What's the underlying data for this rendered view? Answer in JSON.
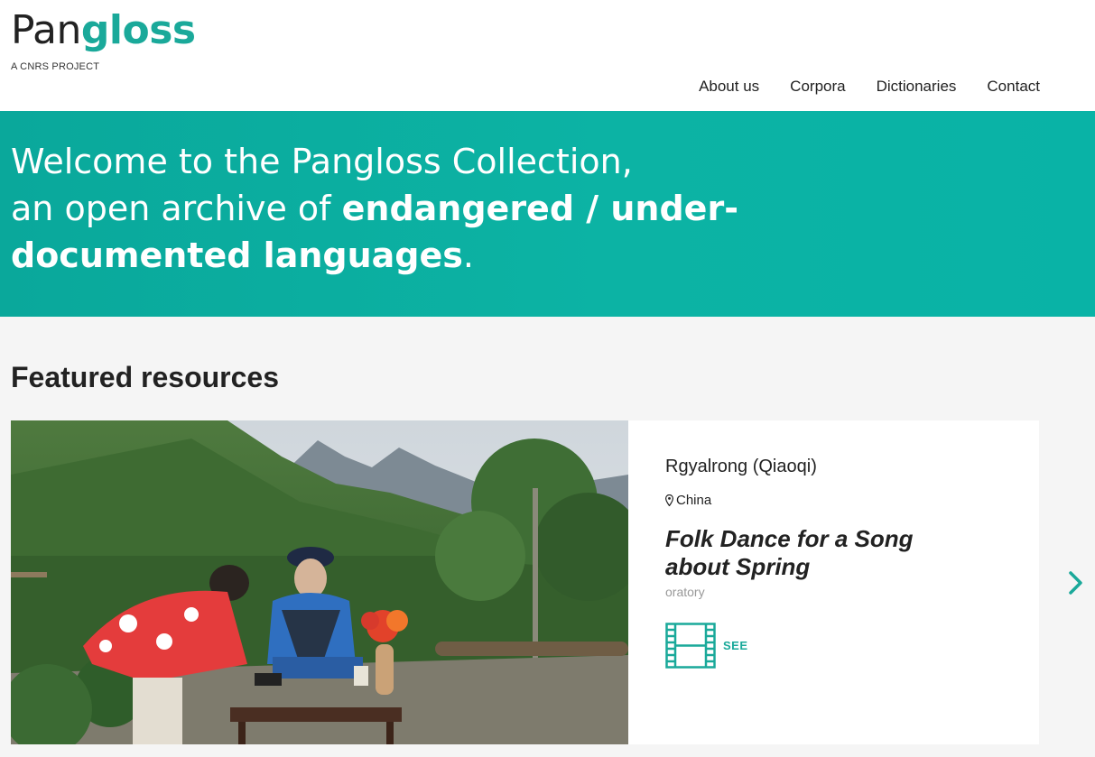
{
  "header": {
    "logo": {
      "part1": "Pan",
      "part2": "gloss",
      "tagline": "A CNRS PROJECT"
    },
    "nav": [
      {
        "label": "About us"
      },
      {
        "label": "Corpora"
      },
      {
        "label": "Dictionaries"
      },
      {
        "label": "Contact"
      }
    ]
  },
  "hero": {
    "line1": "Welcome to the Pangloss Collection,",
    "line2_prefix": "an open archive of ",
    "line2_strong": "endangered / under-documented languages",
    "line2_suffix": "."
  },
  "featured": {
    "title": "Featured resources",
    "item": {
      "language": "Rgyalrong (Qiaoqi)",
      "country": "China",
      "title": "Folk Dance for a Song about Spring",
      "genre": "oratory",
      "action_label": "SEE",
      "media_icon": "film-icon"
    }
  },
  "colors": {
    "accent": "#1aa99a",
    "hero_bg": "#0cb3a4",
    "text": "#222222",
    "muted": "#999999"
  }
}
